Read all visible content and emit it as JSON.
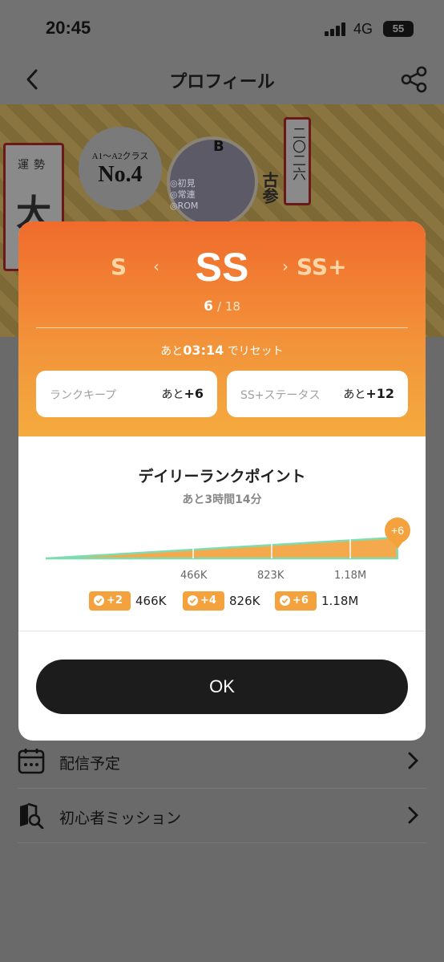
{
  "status_bar": {
    "time": "20:45",
    "network": "4G",
    "battery": "55"
  },
  "nav": {
    "title": "プロフィール",
    "back_icon": "chevron-left-icon",
    "share_icon": "share-icon"
  },
  "banner": {
    "fortune_top": "運勢",
    "fortune_big": "大",
    "class_range": "A1～A2クラス",
    "rank_no": "No.4",
    "year": "二〇二六",
    "kosan": "古参",
    "brand": "B",
    "avatar_tags": [
      "◎初見",
      "◎常連",
      "◎ROM"
    ]
  },
  "modal": {
    "rank_prev": "S",
    "rank_current": "SS",
    "rank_next": "SS+",
    "progress_current": "6",
    "progress_total": "/ 18",
    "reset_prefix": "あと",
    "reset_time": "03:14",
    "reset_suffix": "でリセット",
    "rank_keep": {
      "label": "ランクキープ",
      "prefix": "あと",
      "value": "+6"
    },
    "ss_plus_status": {
      "label": "SS+ステータス",
      "prefix": "あと",
      "value": "+12"
    },
    "daily_title": "デイリーランクポイント",
    "daily_subtitle": "あと3時間14分",
    "ok_label": "OK"
  },
  "chart_data": {
    "type": "area",
    "current_badge": "+6",
    "ticks": [
      "466K",
      "823K",
      "1.18M"
    ],
    "legend": [
      {
        "badge": "+2",
        "value": "466K"
      },
      {
        "badge": "+4",
        "value": "826K"
      },
      {
        "badge": "+6",
        "value": "1.18M"
      }
    ],
    "fill_color": "#f3a23d",
    "line_color": "#7fdcb0"
  },
  "menu": {
    "items": [
      {
        "label": "配信予定",
        "icon": "calendar-icon"
      },
      {
        "label": "初心者ミッション",
        "icon": "book-search-icon"
      }
    ]
  }
}
